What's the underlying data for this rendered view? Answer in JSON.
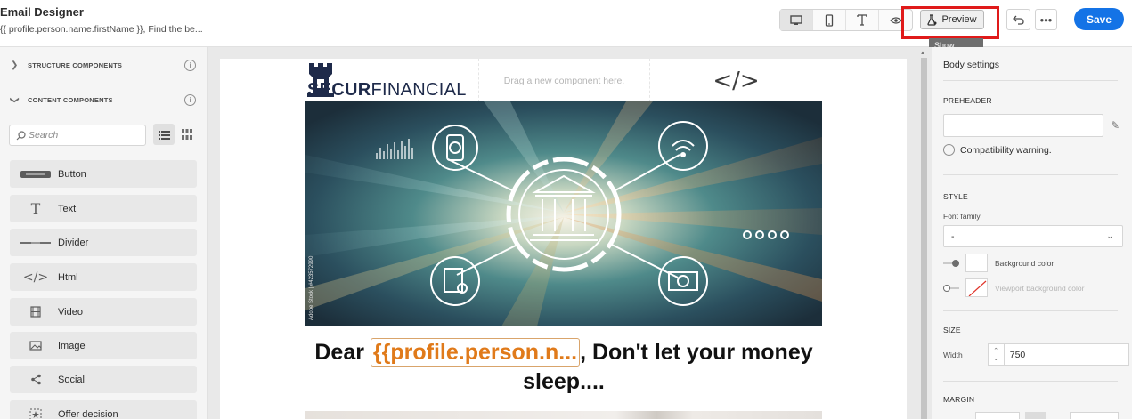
{
  "header": {
    "title": "Email Designer",
    "subtitle": "{{ profile.person.name.firstName }}, Find the be...",
    "view_buttons": [
      "desktop-icon",
      "mobile-icon",
      "text-icon",
      "eye-icon"
    ],
    "preview_label": "Preview",
    "tooltip": "Show Preview",
    "save_label": "Save"
  },
  "left_panel": {
    "structure_label": "STRUCTURE COMPONENTS",
    "content_label": "CONTENT COMPONENTS",
    "search_placeholder": "Search",
    "components": [
      {
        "label": "Button",
        "icon": "button-icon"
      },
      {
        "label": "Text",
        "icon": "text-icon"
      },
      {
        "label": "Divider",
        "icon": "divider-icon"
      },
      {
        "label": "Html",
        "icon": "html-icon"
      },
      {
        "label": "Video",
        "icon": "video-icon"
      },
      {
        "label": "Image",
        "icon": "image-icon"
      },
      {
        "label": "Social",
        "icon": "share-icon"
      },
      {
        "label": "Offer decision",
        "icon": "offer-decision-icon"
      }
    ]
  },
  "canvas": {
    "logo_bold": "SECUR",
    "logo_regular": "FINANCIAL",
    "drop_hint": "Drag a new component here.",
    "html_placeholder": "</>",
    "hero_watermark": "Adobe Stock | #423572990",
    "headline_prefix": "Dear ",
    "personalization_tag": "{{profile.person.n...",
    "headline_suffix": ", Don't let your money sleep...."
  },
  "right_panel": {
    "body_settings": "Body settings",
    "preheader_label": "PREHEADER",
    "preheader_value": "",
    "compat_warning": "Compatibility warning.",
    "style_label": "STYLE",
    "font_family_label": "Font family",
    "font_family_value": "-",
    "background_color_label": "Background color",
    "background_color": "#ffffff",
    "viewport_bg_label": "Viewport background color",
    "size_label": "SIZE",
    "width_label": "Width",
    "width_value": "750",
    "margin_label": "MARGIN"
  },
  "colors": {
    "accent": "#1473e6",
    "highlight": "#e01a1a",
    "personalization": "#e07a1a"
  }
}
